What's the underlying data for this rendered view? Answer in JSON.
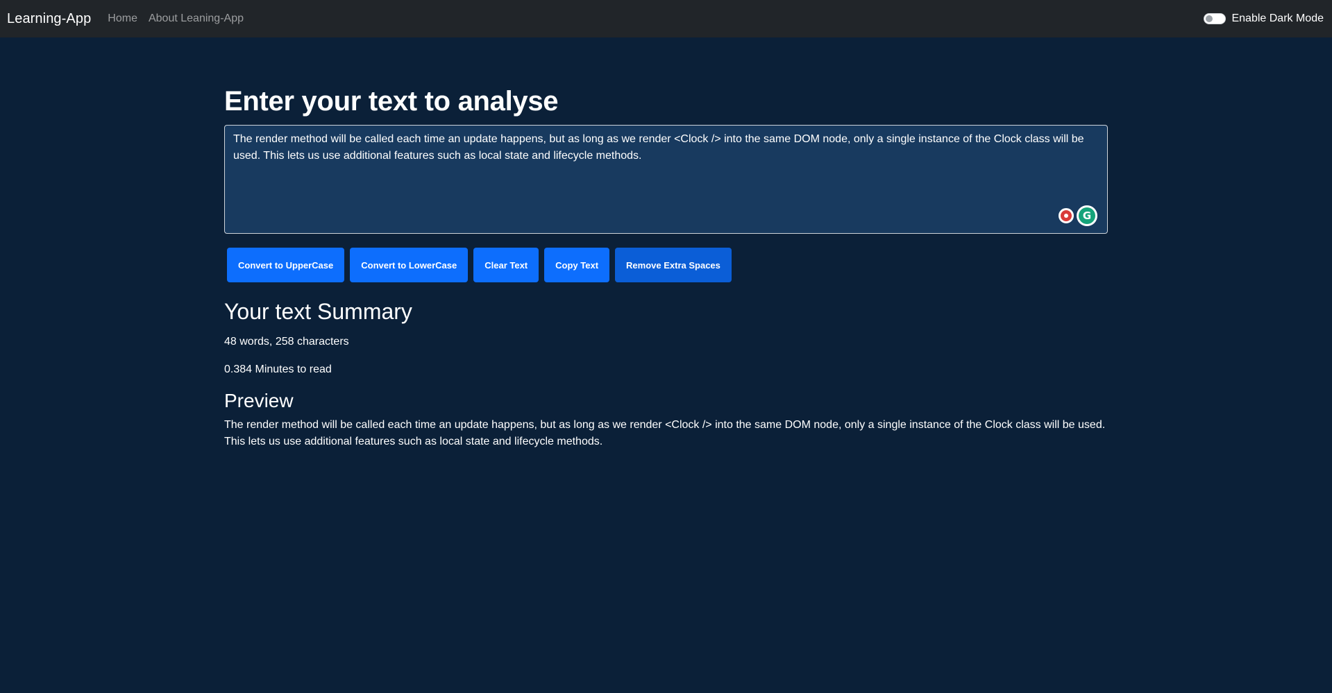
{
  "navbar": {
    "brand": "Learning-App",
    "links": [
      "Home",
      "About Leaning-App"
    ],
    "dark_mode_label": "Enable Dark Mode"
  },
  "main": {
    "heading": "Enter your text to analyse",
    "textarea_value": "The render method will be called each time an update happens, but as long as we render <Clock /> into the same DOM node, only a single instance of the Clock class will be used. This lets us use additional features such as local state and lifecycle methods.",
    "buttons": [
      "Convert to UpperCase",
      "Convert to LowerCase",
      "Clear Text",
      "Copy Text",
      "Remove Extra Spaces"
    ]
  },
  "summary": {
    "heading": "Your text Summary",
    "counts": "48 words, 258 characters",
    "read_time": "0.384 Minutes to read"
  },
  "preview": {
    "heading": "Preview",
    "text": "The render method will be called each time an update happens, but as long as we render <Clock /> into the same DOM node, only a single instance of the Clock class will be used. This lets us use additional features such as local state and lifecycle methods."
  },
  "colors": {
    "background": "#0b2038",
    "navbar": "#212529",
    "textarea": "#183a5f",
    "button": "#0d6efd"
  },
  "icons": [
    "target-icon",
    "grammarly-icon"
  ]
}
